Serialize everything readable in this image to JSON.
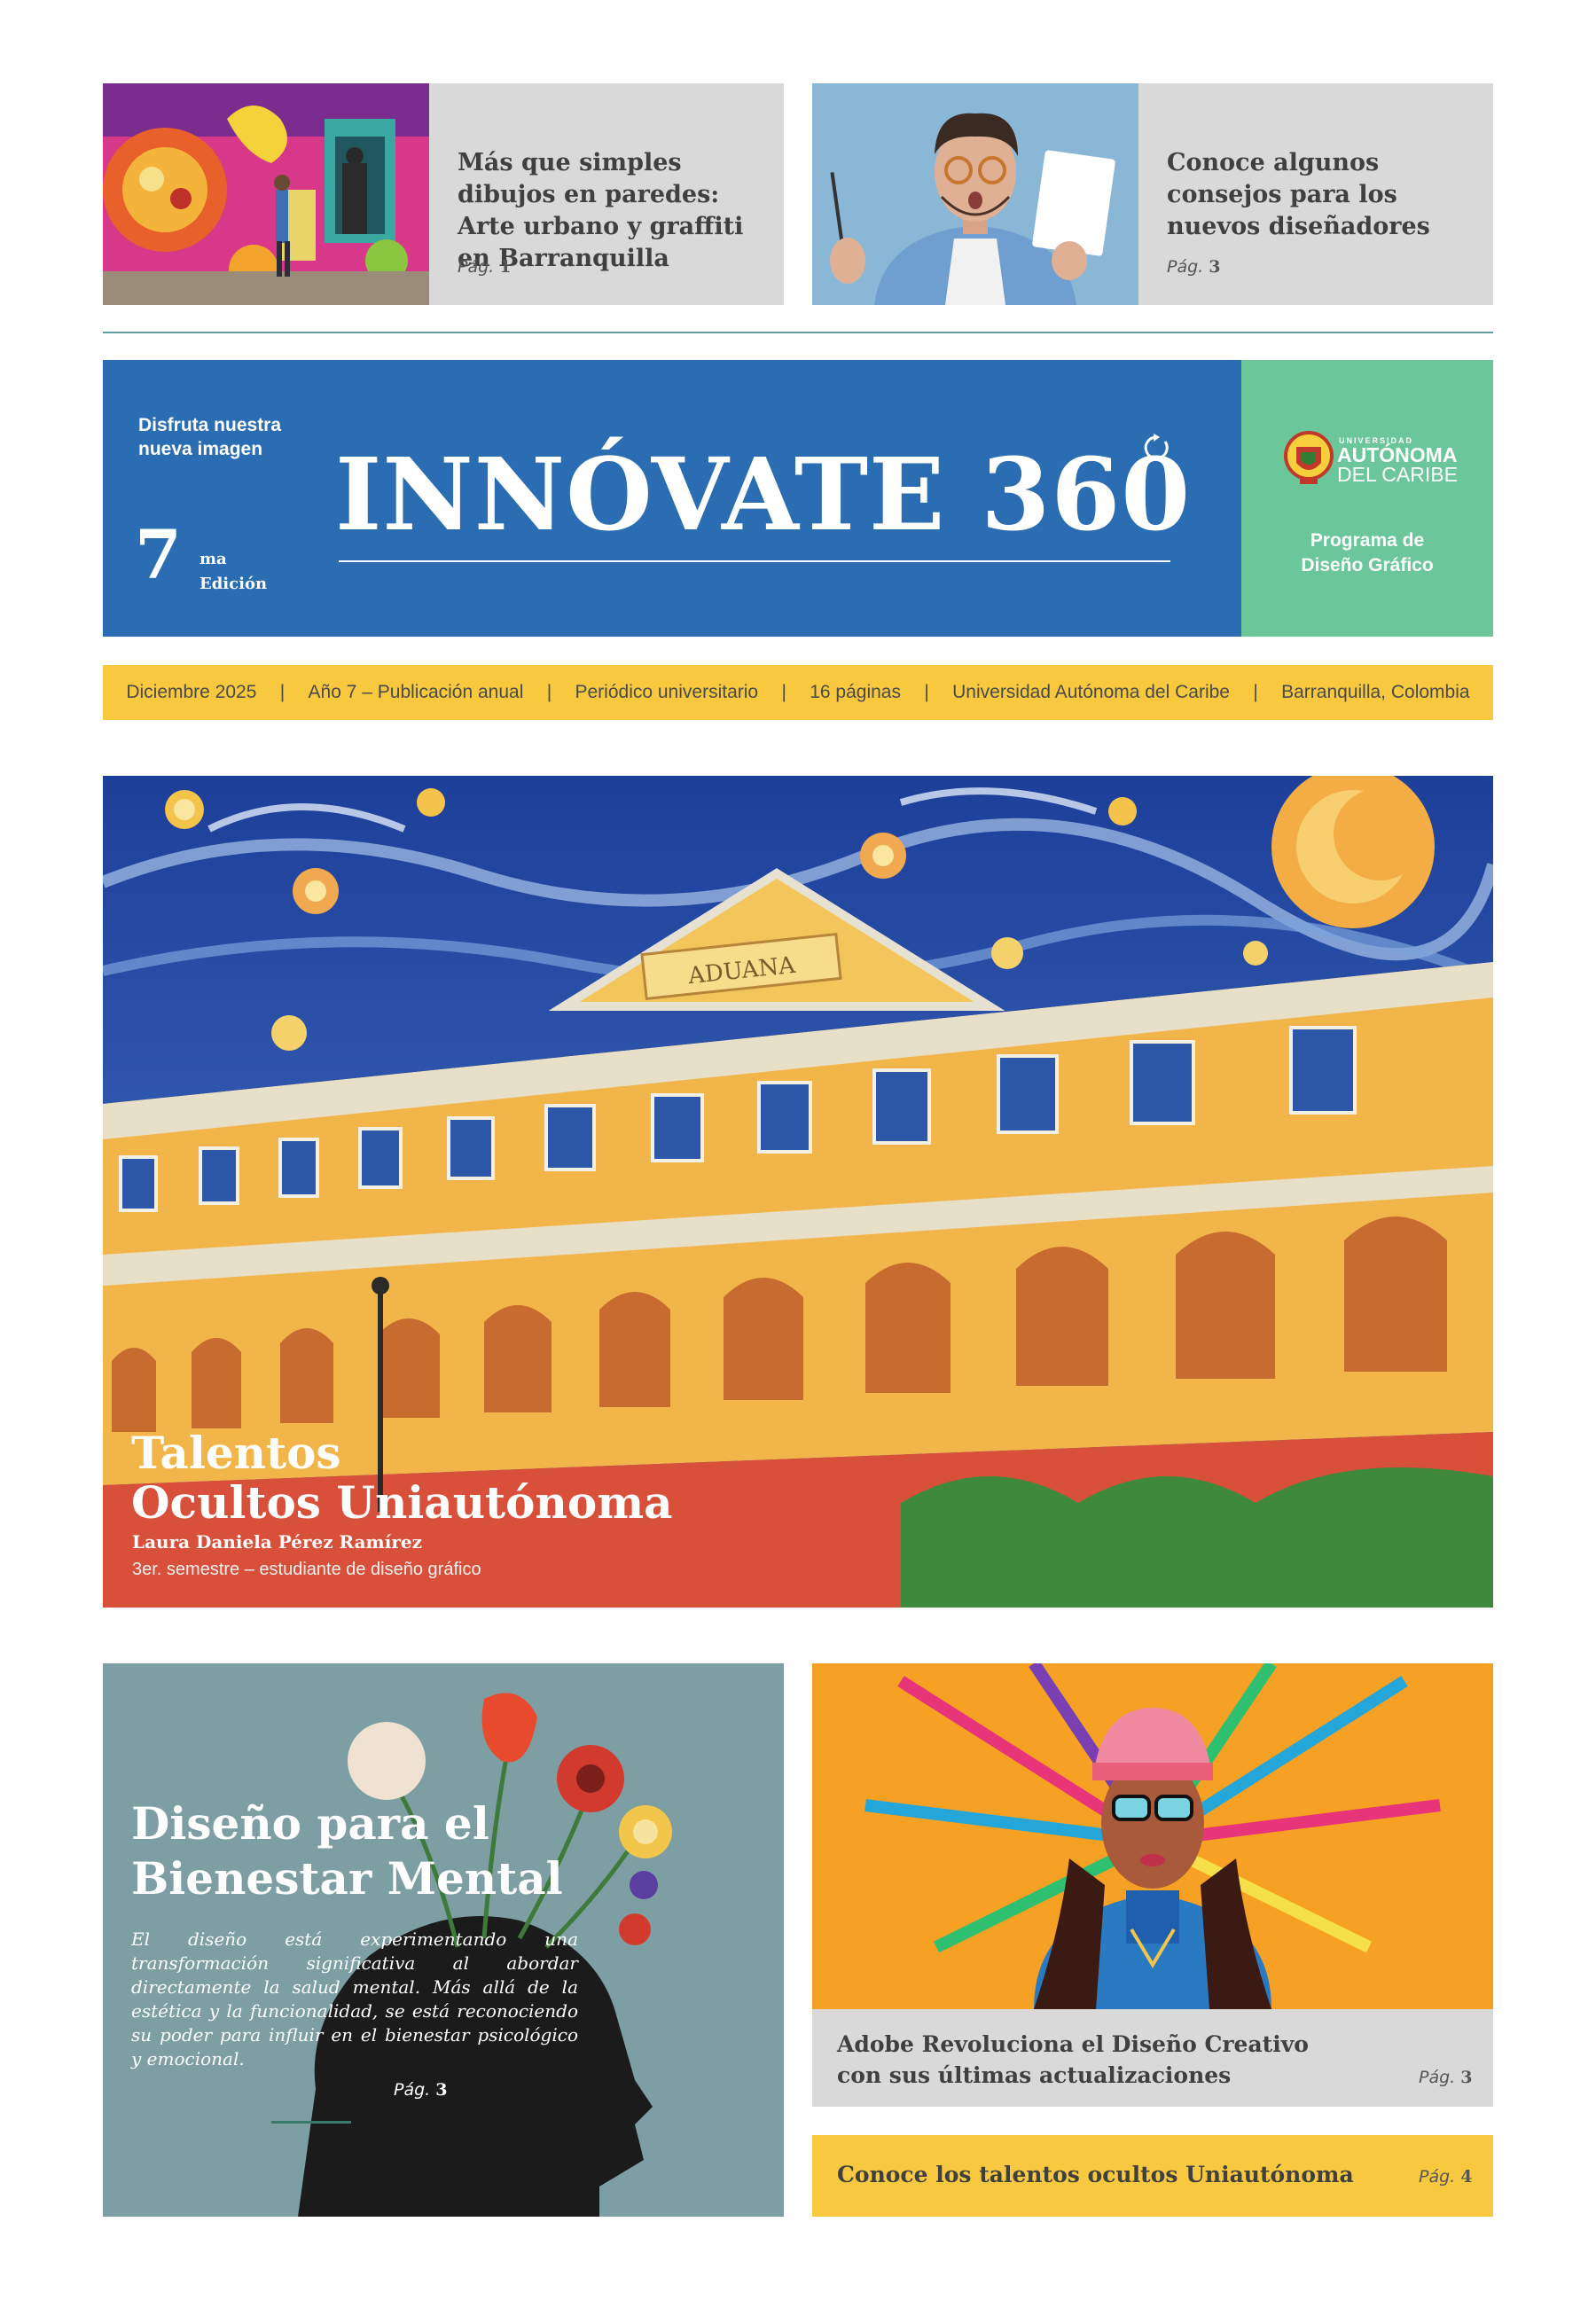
{
  "teasers": [
    {
      "title": "Más que simples dibujos en paredes: Arte urbano y graffiti en Barranquilla",
      "page_prefix": "Pág.",
      "page_num": "1"
    },
    {
      "title": "Conoce algunos consejos para los nuevos diseñadores",
      "page_prefix": "Pág.",
      "page_num": "3"
    }
  ],
  "masthead": {
    "tagline_line1": "Disfruta nuestra",
    "tagline_line2": "nueva imagen",
    "edition_number": "7",
    "edition_suffix": "ma",
    "edition_label": "Edición",
    "title": "INNÓVATE 360",
    "university_small": "UNIVERSIDAD",
    "university_line1": "AUTÓNOMA",
    "university_line2": "DEL CARIBE",
    "program_line1": "Programa de",
    "program_line2": "Diseño Gráfico"
  },
  "infobar": {
    "items": [
      "Diciembre 2025",
      "Año 7 – Publicación anual",
      "Periódico universitario",
      "16 páginas",
      "Universidad Autónoma del Caribe",
      "Barranquilla, Colombia"
    ],
    "separator": "|"
  },
  "hero": {
    "building_sign": "ADUANA",
    "title_line1": "Talentos",
    "title_line2": "Ocultos Uniautónoma",
    "author": "Laura Daniela Pérez Ramírez",
    "author_role": "3er. semestre – estudiante de diseño gráfico"
  },
  "wellbeing": {
    "title_line1": "Diseño para el",
    "title_line2": "Bienestar Mental",
    "body": "El diseño está experimentando una transformación significativa al abordar directamente la salud mental. Más allá de la estética y la funcionalidad, se está reconociendo su poder para influir en el bienestar psicológico y emocional.",
    "page_prefix": "Pág.",
    "page_num": "3"
  },
  "adobe": {
    "title": "Adobe Revoluciona el Diseño Creativo con sus últimas actualizaciones",
    "page_prefix": "Pág.",
    "page_num": "3"
  },
  "talents": {
    "title": "Conoce los talentos ocultos Uniautónoma",
    "page_prefix": "Pág.",
    "page_num": "4"
  },
  "colors": {
    "masthead_blue": "#2a6db3",
    "masthead_green": "#6bc79a",
    "accent_yellow": "#f8c93f",
    "card_gray": "#d9d9d9",
    "rule_teal": "#5f9ea0"
  }
}
